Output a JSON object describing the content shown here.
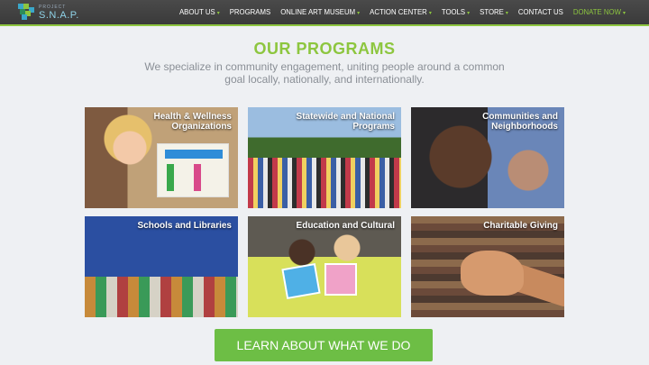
{
  "header": {
    "logo_top": "PROJECT",
    "logo_main": "S.N.A.P.",
    "nav": [
      {
        "label": "ABOUT US",
        "dropdown": true
      },
      {
        "label": "PROGRAMS",
        "dropdown": false
      },
      {
        "label": "ONLINE ART MUSEUM",
        "dropdown": true
      },
      {
        "label": "ACTION CENTER",
        "dropdown": true
      },
      {
        "label": "TOOLS",
        "dropdown": true
      },
      {
        "label": "STORE",
        "dropdown": true
      },
      {
        "label": "CONTACT US",
        "dropdown": false
      },
      {
        "label": "DONATE NOW",
        "dropdown": true
      }
    ],
    "accent_color": "#8dc63f"
  },
  "main": {
    "title": "OUR PROGRAMS",
    "subtitle": "We specialize in community engagement, uniting people around a common goal locally, nationally, and internationally.",
    "tiles": [
      {
        "label": "Health & Wellness Organizations"
      },
      {
        "label": "Statewide and National Programs"
      },
      {
        "label": "Communities and Neighborhoods"
      },
      {
        "label": "Schools and Libraries"
      },
      {
        "label": "Education and Cultural"
      },
      {
        "label": "Charitable Giving"
      }
    ],
    "cta_label": "LEARN ABOUT WHAT WE DO"
  }
}
